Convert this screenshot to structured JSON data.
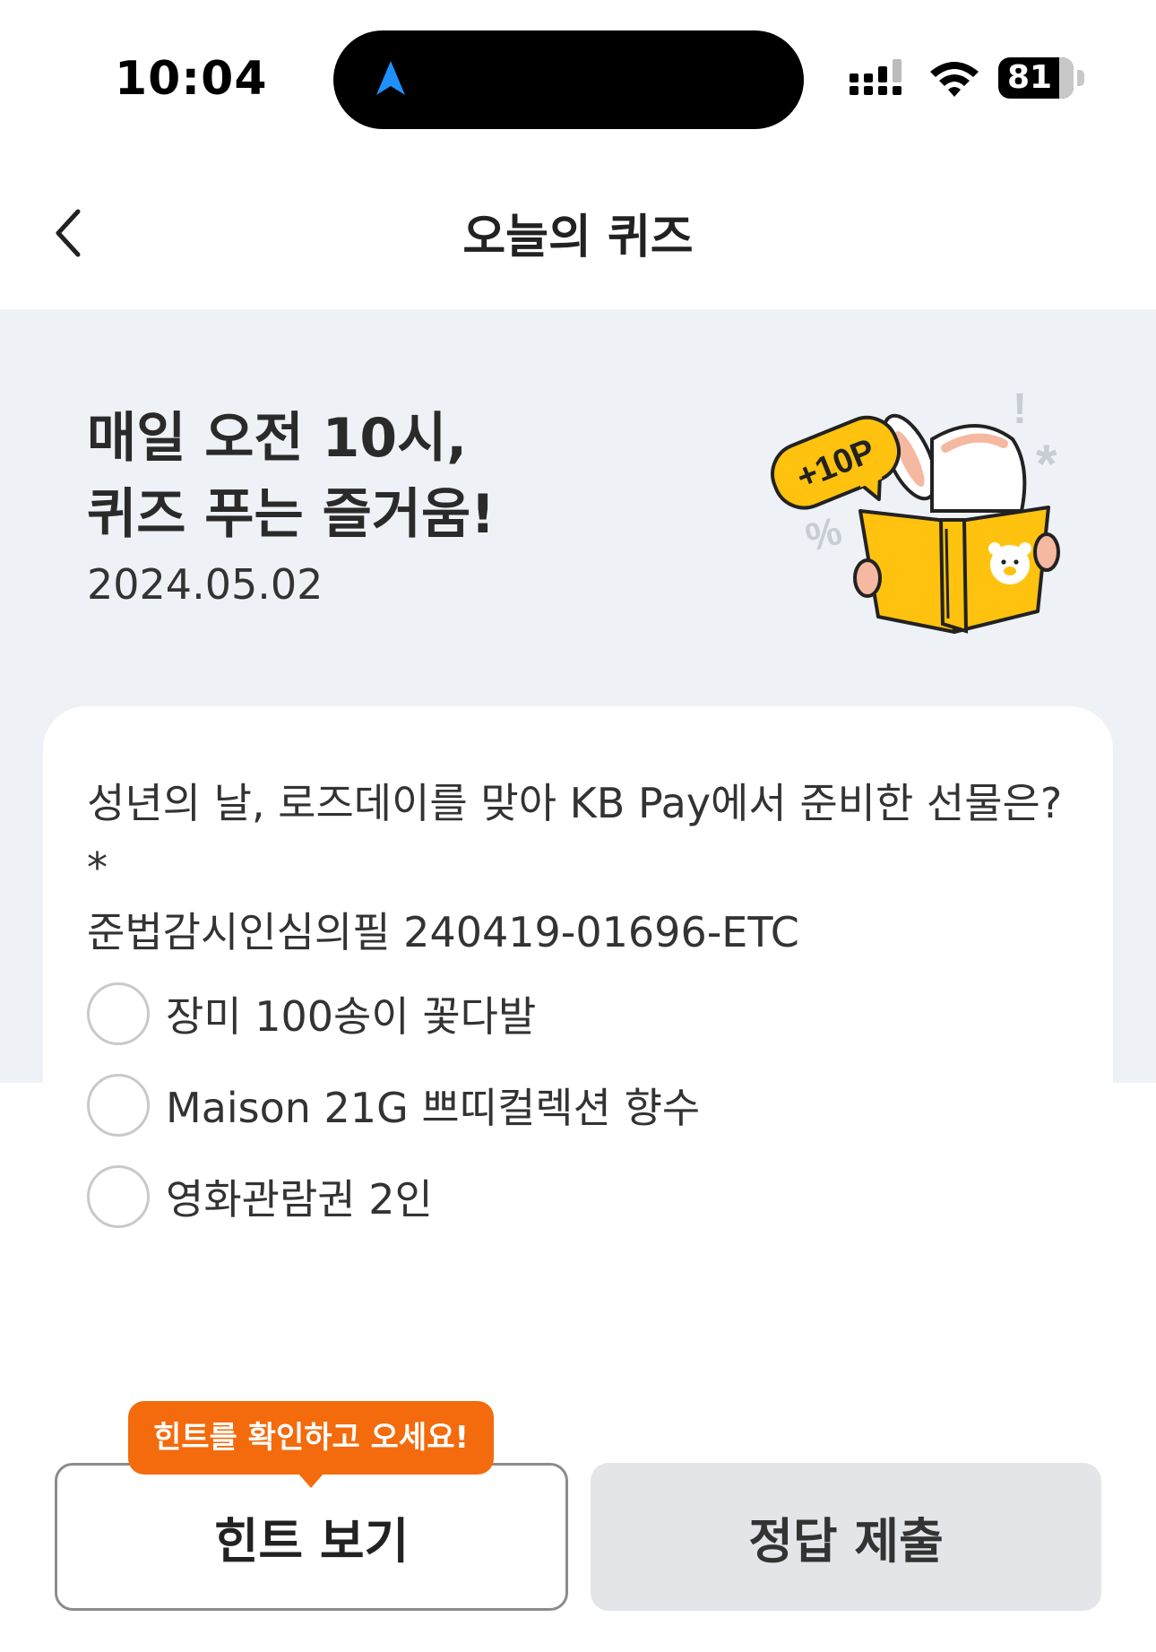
{
  "status_bar": {
    "time": "10:04",
    "battery": "81",
    "battery_level": 0.81,
    "icons": [
      "navigation-arrow-icon",
      "cellular-signal-icon",
      "wifi-icon",
      "battery-icon"
    ]
  },
  "header": {
    "title": "오늘의 퀴즈",
    "back_icon": "chevron-left-icon"
  },
  "hero": {
    "title_line1": "매일 오전 10시,",
    "title_line2": "퀴즈 푸는 즐거움!",
    "date": "2024.05.02",
    "points_badge": "+10P"
  },
  "quiz": {
    "question_line1": "성년의 날, 로즈데이를 맞아 KB Pay에서 준비한 선물은? *",
    "question_line2": "준법감시인심의필 240419-01696-ETC",
    "options": [
      {
        "label": "장미 100송이 꽃다발",
        "selected": false
      },
      {
        "label": "Maison 21G 쁘띠컬렉션 향수",
        "selected": false
      },
      {
        "label": "영화관람권 2인",
        "selected": false
      }
    ]
  },
  "actions": {
    "tooltip": "힌트를 확인하고 오세요!",
    "hint_label": "힌트 보기",
    "submit_label": "정답 제출"
  },
  "colors": {
    "band": "#eef1f6",
    "accent_orange": "#f36b0c",
    "book_yellow": "#ffc20e",
    "submit_disabled": "#e3e5e9",
    "nav_arrow_blue": "#1e90ff"
  }
}
